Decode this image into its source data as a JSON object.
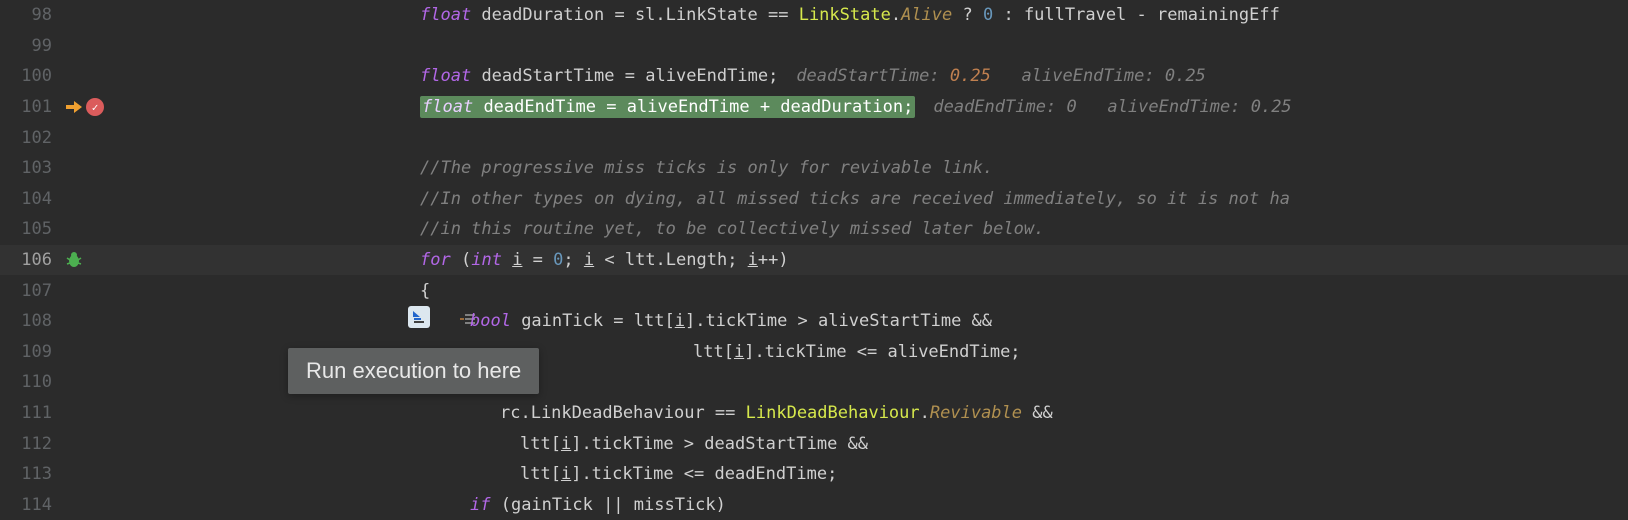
{
  "lines": {
    "98": {
      "num": "98"
    },
    "99": {
      "num": "99"
    },
    "100": {
      "num": "100",
      "kw": "float",
      "id": "deadStartTime",
      "eq": "=",
      "rhs": "aliveEndTime;",
      "hint1_lbl": "deadStartTime:",
      "hint1_val": "0.25",
      "hint2_lbl": "aliveEndTime:",
      "hint2_val": "0.25"
    },
    "101": {
      "num": "101",
      "kw": "float",
      "id": "deadEndTime",
      "eq": "=",
      "rhs": "aliveEndTime + deadDuration;",
      "hint1_lbl": "deadEndTime:",
      "hint1_val": "0",
      "hint2_lbl": "aliveEndTime:",
      "hint2_val": "0.25"
    },
    "102": {
      "num": "102"
    },
    "103": {
      "num": "103",
      "comment": "//The progressive miss ticks is only for revivable link."
    },
    "104": {
      "num": "104",
      "comment": "//In other types on dying, all missed ticks are received immediately, so it is not ha"
    },
    "105": {
      "num": "105",
      "comment": "//in this routine yet, to be collectively missed later below."
    },
    "106": {
      "num": "106",
      "for": "for",
      "p1": "(",
      "int": "int",
      "i": "i",
      "eq": " = ",
      "zero": "0",
      "sc1": "; ",
      "cond": "i < ltt.Length; ",
      "inc": "i++",
      "p2": ")"
    },
    "107": {
      "num": "107",
      "brace": "{"
    },
    "108": {
      "num": "108",
      "bool": "bool",
      "expr": " gainTick = ltt[",
      "i": "i",
      "rest": "].tickTime > aliveStartTime &&"
    },
    "109": {
      "num": "109",
      "pre": "ltt[",
      "i": "i",
      "rest": "].tickTime <= aliveEndTime;"
    },
    "110": {
      "num": "110"
    },
    "111": {
      "num": "111",
      "pre": "rc.LinkDeadBehaviour == ",
      "cls": "LinkDeadBehaviour",
      "dot": ".",
      "enum": "Revivable",
      "rest": " &&"
    },
    "112": {
      "num": "112",
      "pre": "ltt[",
      "i": "i",
      "rest": "].tickTime > deadStartTime &&"
    },
    "113": {
      "num": "113",
      "pre": "ltt[",
      "i": "i",
      "rest": "].tickTime <= deadEndTime;"
    },
    "114": {
      "num": "114",
      "if": "if",
      "cond": " (gainTick || missTick)"
    }
  },
  "partial_line_98": {
    "kw": "float",
    "expr": " deadDuration = sl.LinkState == ",
    "cls": "LinkState",
    "dot": ".",
    "enum": "Alive",
    "tern": " ? ",
    "zero": "0",
    "rest": " : fullTravel - remainingEff"
  },
  "tooltip": "Run execution to here",
  "icons": {
    "execution_arrow": "execution-pointer-icon",
    "breakpoint": "breakpoint-icon",
    "bug": "bug-icon",
    "run_to_here": "run-to-here-icon"
  }
}
